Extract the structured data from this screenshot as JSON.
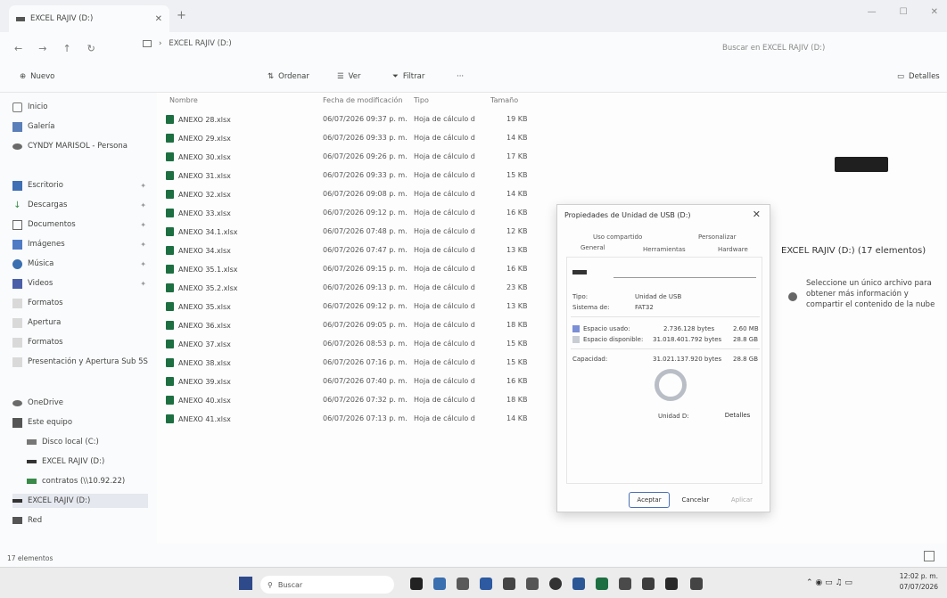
{
  "window": {
    "tab_title": "EXCEL RAJIV (D:)",
    "new_tab": "+",
    "controls": [
      "—",
      "☐",
      "✕"
    ]
  },
  "address": {
    "breadcrumb_sep": "›",
    "path": "EXCEL RAJIV (D:)",
    "search_placeholder": "Buscar en EXCEL RAJIV (D:)"
  },
  "commands": {
    "new": "Nuevo",
    "sort": "Ordenar",
    "view": "Ver",
    "filter": "Filtrar",
    "more": "···",
    "details": "Detalles"
  },
  "sidebar": {
    "items": [
      {
        "label": "Inicio"
      },
      {
        "label": "Galería"
      },
      {
        "label": "CYNDY MARISOL - Persona"
      },
      {
        "label": "Escritorio"
      },
      {
        "label": "Descargas"
      },
      {
        "label": "Documentos"
      },
      {
        "label": "Imágenes"
      },
      {
        "label": "Música"
      },
      {
        "label": "Videos"
      },
      {
        "label": "Formatos"
      },
      {
        "label": "Apertura"
      },
      {
        "label": "Formatos"
      },
      {
        "label": "Presentación y Apertura Sub 5S"
      },
      {
        "label": "OneDrive"
      },
      {
        "label": "Este equipo"
      },
      {
        "label": "Disco local (C:)"
      },
      {
        "label": "EXCEL RAJIV (D:)"
      },
      {
        "label": "contratos (\\\\10.92.22)"
      },
      {
        "label": "EXCEL RAJIV (D:)"
      },
      {
        "label": "Red"
      }
    ]
  },
  "list": {
    "headers": {
      "name": "Nombre",
      "date": "Fecha de modificación",
      "type": "Tipo",
      "size": "Tamaño"
    },
    "rows": [
      {
        "name": "ANEXO 28.xlsx",
        "date": "06/07/2026 09:37 p. m.",
        "type": "Hoja de cálculo d",
        "size": "19 KB"
      },
      {
        "name": "ANEXO 29.xlsx",
        "date": "06/07/2026 09:33 p. m.",
        "type": "Hoja de cálculo d",
        "size": "14 KB"
      },
      {
        "name": "ANEXO 30.xlsx",
        "date": "06/07/2026 09:26 p. m.",
        "type": "Hoja de cálculo d",
        "size": "17 KB"
      },
      {
        "name": "ANEXO 31.xlsx",
        "date": "06/07/2026 09:33 p. m.",
        "type": "Hoja de cálculo d",
        "size": "15 KB"
      },
      {
        "name": "ANEXO 32.xlsx",
        "date": "06/07/2026 09:08 p. m.",
        "type": "Hoja de cálculo d",
        "size": "14 KB"
      },
      {
        "name": "ANEXO 33.xlsx",
        "date": "06/07/2026 09:12 p. m.",
        "type": "Hoja de cálculo d",
        "size": "16 KB"
      },
      {
        "name": "ANEXO 34.1.xlsx",
        "date": "06/07/2026 07:48 p. m.",
        "type": "Hoja de cálculo d",
        "size": "12 KB"
      },
      {
        "name": "ANEXO 34.xlsx",
        "date": "06/07/2026 07:47 p. m.",
        "type": "Hoja de cálculo d",
        "size": "13 KB"
      },
      {
        "name": "ANEXO 35.1.xlsx",
        "date": "06/07/2026 09:15 p. m.",
        "type": "Hoja de cálculo d",
        "size": "16 KB"
      },
      {
        "name": "ANEXO 35.2.xlsx",
        "date": "06/07/2026 09:13 p. m.",
        "type": "Hoja de cálculo d",
        "size": "23 KB"
      },
      {
        "name": "ANEXO 35.xlsx",
        "date": "06/07/2026 09:12 p. m.",
        "type": "Hoja de cálculo d",
        "size": "13 KB"
      },
      {
        "name": "ANEXO 36.xlsx",
        "date": "06/07/2026 09:05 p. m.",
        "type": "Hoja de cálculo d",
        "size": "18 KB"
      },
      {
        "name": "ANEXO 37.xlsx",
        "date": "06/07/2026 08:53 p. m.",
        "type": "Hoja de cálculo d",
        "size": "15 KB"
      },
      {
        "name": "ANEXO 38.xlsx",
        "date": "06/07/2026 07:16 p. m.",
        "type": "Hoja de cálculo d",
        "size": "15 KB"
      },
      {
        "name": "ANEXO 39.xlsx",
        "date": "06/07/2026 07:40 p. m.",
        "type": "Hoja de cálculo d",
        "size": "16 KB"
      },
      {
        "name": "ANEXO 40.xlsx",
        "date": "06/07/2026 07:32 p. m.",
        "type": "Hoja de cálculo d",
        "size": "18 KB"
      },
      {
        "name": "ANEXO 41.xlsx",
        "date": "06/07/2026 07:13 p. m.",
        "type": "Hoja de cálculo d",
        "size": "14 KB"
      }
    ]
  },
  "details_pane": {
    "title": "EXCEL RAJIV (D:) (17 elementos)",
    "info": "Seleccione un único archivo para obtener más información y compartir el contenido de la nube"
  },
  "dialog": {
    "title": "Propiedades de Unidad de USB (D:)",
    "close": "✕",
    "tabs_top": [
      "Uso compartido",
      "Personalizar"
    ],
    "tabs_bottom": [
      "General",
      "Herramientas",
      "Hardware"
    ],
    "type_label": "Tipo:",
    "type_value": "Unidad de USB",
    "fs_label": "Sistema de:",
    "fs_value": "FAT32",
    "used_label": "Espacio usado:",
    "used_bytes": "2.736.128 bytes",
    "used_size": "2.60 MB",
    "free_label": "Espacio disponible:",
    "free_bytes": "31.018.401.792 bytes",
    "free_size": "28.8 GB",
    "cap_label": "Capacidad:",
    "cap_bytes": "31.021.137.920 bytes",
    "cap_size": "28.8 GB",
    "drive_label": "Unidad D:",
    "details_btn": "Detalles",
    "ok": "Aceptar",
    "cancel": "Cancelar",
    "apply": "Aplicar",
    "colors": {
      "used": "#7b8ed6",
      "free": "#c8ccd4"
    }
  },
  "status": {
    "count": "17 elementos"
  },
  "taskbar": {
    "search": "Buscar",
    "time": "12:02 p. m.",
    "date": "07/07/2026"
  }
}
